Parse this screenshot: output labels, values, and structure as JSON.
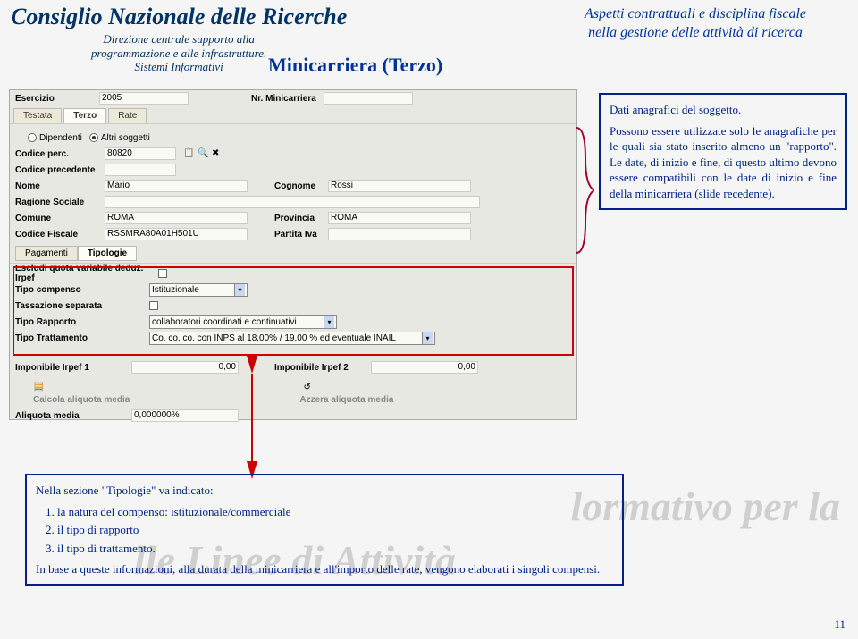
{
  "header": {
    "org": "Consiglio Nazionale delle Ricerche",
    "dir_line1": "Direzione centrale supporto alla",
    "dir_line2": "programmazione e alle infrastrutture.",
    "dir_line3": "Sistemi Informativi",
    "subtitle_line1": "Aspetti contrattuali e disciplina fiscale",
    "subtitle_line2": "nella gestione delle attività di ricerca",
    "title": "Minicarriera (Terzo)"
  },
  "form": {
    "esercizio_label": "Esercizio",
    "esercizio_value": "2005",
    "nr_minicarriera_label": "Nr. Minicarriera",
    "nr_minicarriera_value": "",
    "tabs": {
      "testata": "Testata",
      "terzo": "Terzo",
      "rate": "Rate"
    },
    "dipendenti": "Dipendenti",
    "altri_soggetti": "Altri soggetti",
    "codice_perc_label": "Codice perc.",
    "codice_perc_value": "80820",
    "codice_precedente_label": "Codice precedente",
    "nome_label": "Nome",
    "nome_value": "Mario",
    "cognome_label": "Cognome",
    "cognome_value": "Rossi",
    "ragione_label": "Ragione Sociale",
    "comune_label": "Comune",
    "comune_value": "ROMA",
    "provincia_label": "Provincia",
    "provincia_value": "ROMA",
    "codice_fiscale_label": "Codice Fiscale",
    "codice_fiscale_value": "RSSMRA80A01H501U",
    "partita_iva_label": "Partita Iva",
    "pagamenti": "Pagamenti",
    "tipologie": "Tipologie",
    "escludi_label": "Escludi quota variabile deduz. Irpef",
    "tipo_compenso_label": "Tipo compenso",
    "tipo_compenso_value": "Istituzionale",
    "tassazione_label": "Tassazione separata",
    "tipo_rapporto_label": "Tipo Rapporto",
    "tipo_rapporto_value": "collaboratori coordinati e continuativi",
    "tipo_trattamento_label": "Tipo Trattamento",
    "tipo_trattamento_value": "Co. co. co. con INPS al 18,00% / 19,00 % ed eventuale INAIL",
    "imponibile1_label": "Imponibile Irpef 1",
    "imponibile1_value": "0,00",
    "imponibile2_label": "Imponibile Irpef 2",
    "imponibile2_value": "0,00",
    "calcola_label": "Calcola aliquota media",
    "azzera_label": "Azzera aliquota media",
    "aliquota_label": "Aliquota media",
    "aliquota_value": "0,000000%"
  },
  "note_right": {
    "p1": "Dati anagrafici del soggetto.",
    "p2": "Possono essere utilizzate solo le anagrafiche per le quali sia stato inserito almeno un \"rapporto\". Le date, di inizio e fine, di questo ultimo devono essere compatibili con le date di inizio e fine della minicarriera (slide recedente)."
  },
  "note_bottom": {
    "intro": "Nella sezione \"Tipologie\" va indicato:",
    "li1": "la natura del compenso: istituzionale/commerciale",
    "li2": "il tipo di rapporto",
    "li3": "il tipo di trattamento.",
    "outro": "In base a queste informazioni, alla durata della minicarriera e all'importo delle rate, vengono elaborati i singoli compensi."
  },
  "page": "11",
  "watermarks": {
    "wm2a": "lormativo per la",
    "wm3a": "lle Linee di Attività"
  }
}
